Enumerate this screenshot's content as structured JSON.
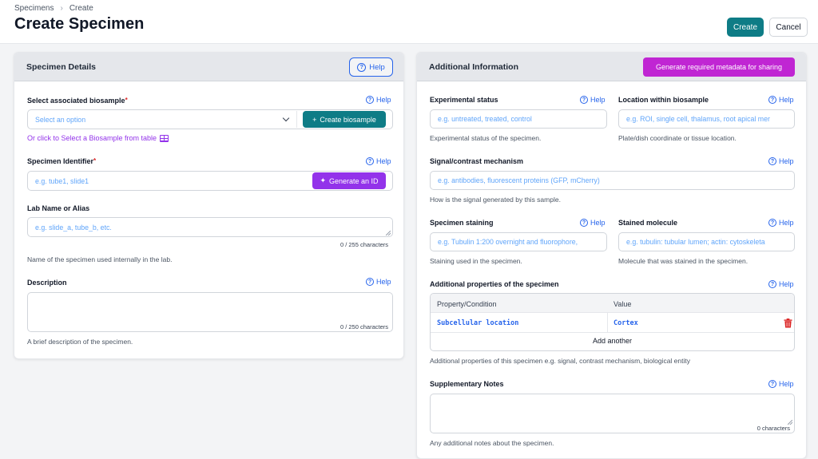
{
  "breadcrumb": {
    "items": [
      "Specimens",
      "Create"
    ]
  },
  "header": {
    "title": "Create Specimen",
    "create_label": "Create",
    "cancel_label": "Cancel"
  },
  "left_card": {
    "title": "Specimen Details",
    "help_label": "Help",
    "biosample": {
      "label": "Select associated biosample",
      "required_mark": "*",
      "help": "Help",
      "select_value": "Select an option",
      "create_button": "Create biosample",
      "link": "Or click to Select a Biosample from table"
    },
    "identifier": {
      "label": "Specimen Identifier",
      "required_mark": "*",
      "help": "Help",
      "placeholder": "e.g. tube1, slide1",
      "generate_button": "Generate an ID"
    },
    "lab_name": {
      "label": "Lab Name or Alias",
      "placeholder": "e.g. slide_a, tube_b, etc.",
      "counter": "0 / 255 characters",
      "hint": "Name of the specimen used internally in the lab."
    },
    "description": {
      "label": "Description",
      "help": "Help",
      "counter": "0 / 250 characters",
      "hint": "A brief description of the specimen."
    }
  },
  "right_card": {
    "title": "Additional Information",
    "generate_metadata_button": "Generate required metadata for sharing",
    "experimental_status": {
      "label": "Experimental status",
      "help": "Help",
      "placeholder": "e.g. untreated, treated, control",
      "hint": "Experimental status of the specimen."
    },
    "location": {
      "label": "Location within biosample",
      "help": "Help",
      "placeholder": "e.g. ROI, single cell, thalamus, root apical mer",
      "hint": "Plate/dish coordinate or tissue location."
    },
    "signal": {
      "label": "Signal/contrast mechanism",
      "help": "Help",
      "placeholder": "e.g. antibodies, fluorescent proteins (GFP, mCherry)",
      "hint": "How is the signal generated by this sample."
    },
    "staining": {
      "label": "Specimen staining",
      "help": "Help",
      "placeholder": "e.g. Tubulin 1:200 overnight and fluorophore,",
      "hint": "Staining used in the specimen."
    },
    "stained_molecule": {
      "label": "Stained molecule",
      "help": "Help",
      "placeholder": "e.g. tubulin: tubular lumen; actin: cytoskeleta",
      "hint": "Molecule that was stained in the specimen."
    },
    "properties": {
      "label": "Additional properties of the specimen",
      "help": "Help",
      "columns": [
        "Property/Condition",
        "Value"
      ],
      "rows": [
        {
          "property": "Subcellular location",
          "value": "Cortex"
        }
      ],
      "add_another": "Add another",
      "hint": "Additional properties of this specimen e.g. signal, contrast mechanism, biological entity"
    },
    "notes": {
      "label": "Supplementary Notes",
      "help": "Help",
      "counter": "0 characters",
      "hint": "Any additional notes about the specimen."
    }
  },
  "colors": {
    "accent_teal": "#0e7c86",
    "purple": "#9333ea",
    "magenta": "#c026d3",
    "help_blue": "#2563eb",
    "placeholder_blue": "#60a5fa"
  }
}
